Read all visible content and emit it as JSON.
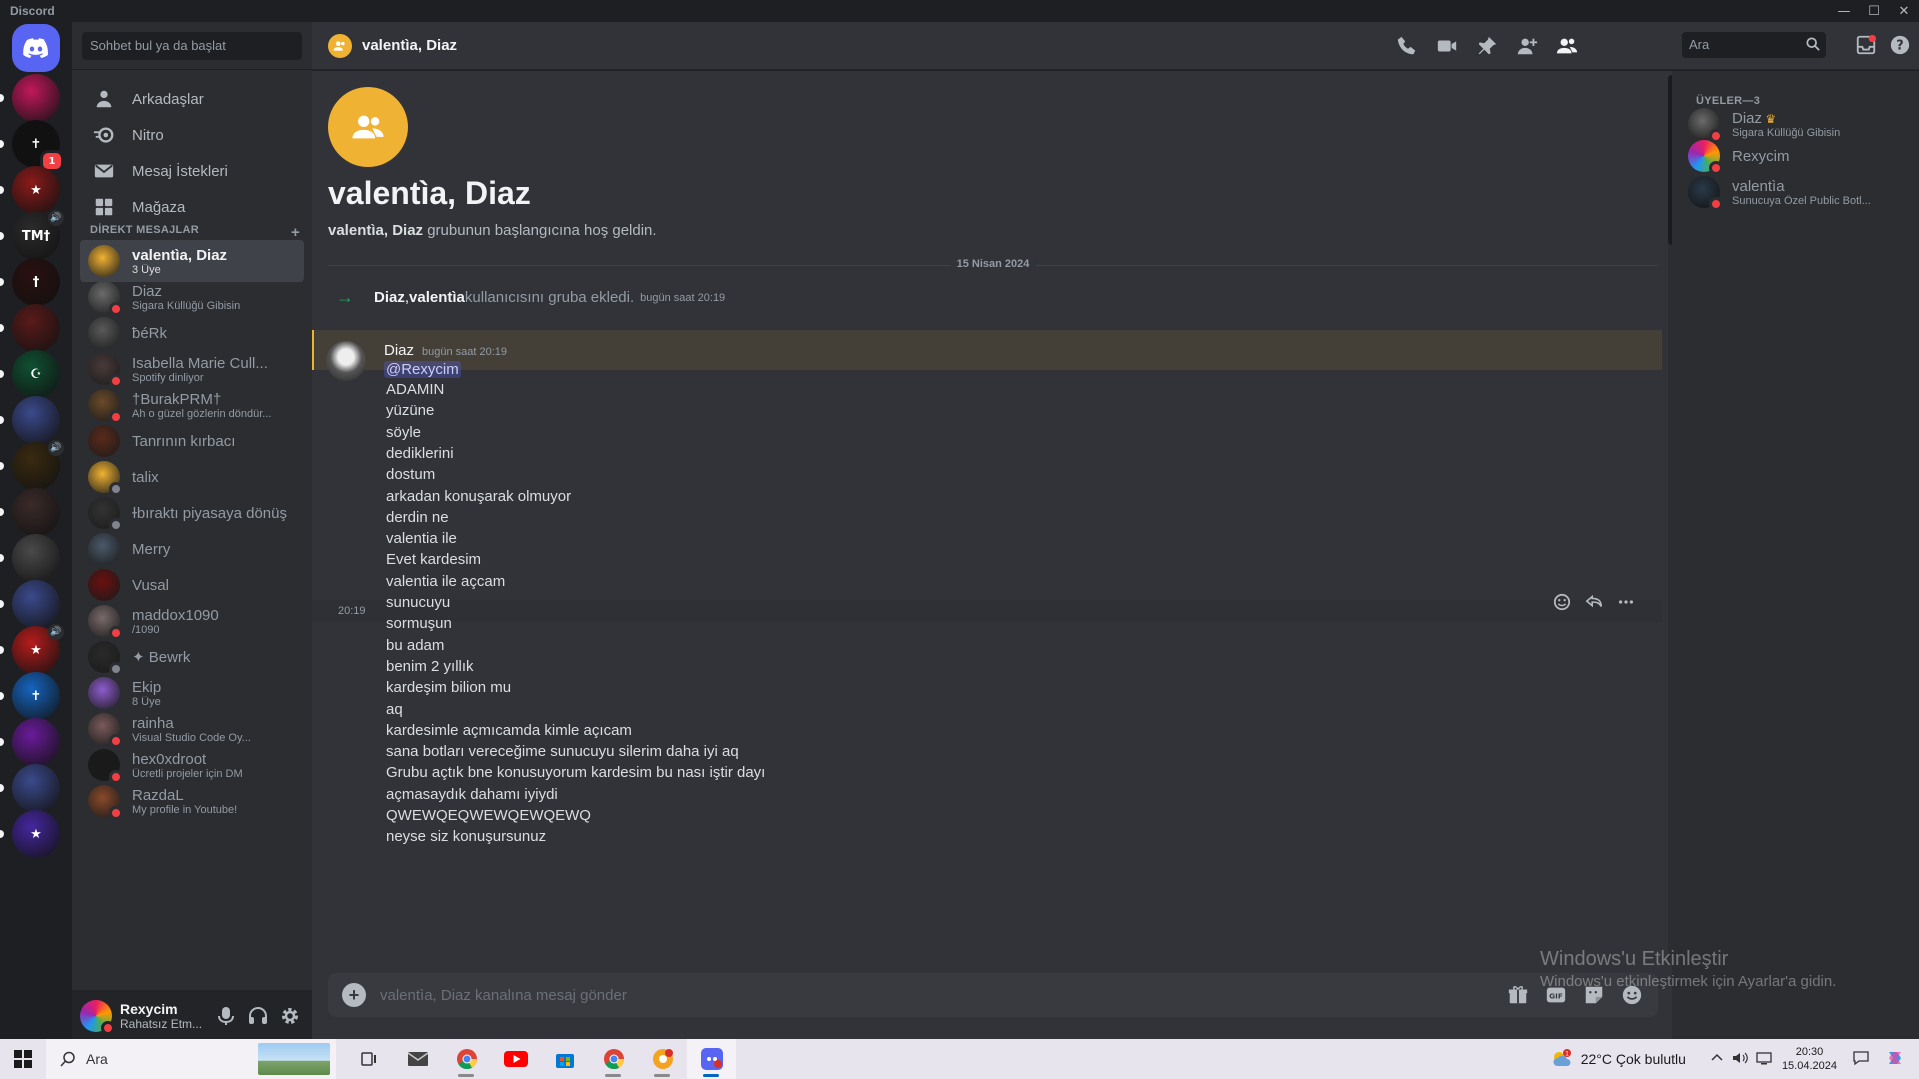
{
  "window": {
    "title": "Discord"
  },
  "rail": {
    "servers": [
      {
        "label": "",
        "color": "#c2185b"
      },
      {
        "label": "✝",
        "color": "#111111",
        "badge": "1"
      },
      {
        "label": "★",
        "color": "#8b1a1a"
      },
      {
        "label": "TM†",
        "color": "#2b2b2b"
      },
      {
        "label": "†",
        "color": "#2a1010"
      },
      {
        "label": "",
        "color": "#5a1a1a"
      },
      {
        "label": "☪",
        "color": "#0f5132"
      },
      {
        "label": "",
        "color": "#3b4a8c"
      },
      {
        "label": "",
        "color": "#3a2a10"
      },
      {
        "label": "",
        "color": "#3b2a2a"
      },
      {
        "label": "",
        "color": "#4a4a4a"
      },
      {
        "label": "",
        "color": "#3b4a8c"
      },
      {
        "label": "★",
        "color": "#b71c1c"
      },
      {
        "label": "✝",
        "color": "#1565c0"
      },
      {
        "label": "",
        "color": "#6a1b9a"
      },
      {
        "label": "",
        "color": "#3b4a8c"
      },
      {
        "label": "★",
        "color": "#4527a0"
      }
    ]
  },
  "sidebar": {
    "search_placeholder": "Sohbet bul ya da başlat",
    "nav": [
      {
        "label": "Arkadaşlar"
      },
      {
        "label": "Nitro"
      },
      {
        "label": "Mesaj İstekleri"
      },
      {
        "label": "Mağaza"
      }
    ],
    "dm_header": "DİREKT MESAJLAR",
    "dms": [
      {
        "name": "valentìa, Diaz",
        "sub": "3 Üye",
        "color": "#f0b232",
        "status": "none",
        "active": true
      },
      {
        "name": "Diaz",
        "sub": "Sigara Küllüğü Gibisin",
        "color": "#6b6b6b",
        "status": "dnd"
      },
      {
        "name": "ƀéRk",
        "sub": "",
        "color": "#5a5a5a",
        "status": "none"
      },
      {
        "name": "Isabella Marie Cull...",
        "sub": "Spotify dinliyor",
        "color": "#4a3a3a",
        "status": "dnd"
      },
      {
        "name": "†BurakPRM†",
        "sub": "Ah o güzel gözlerin döndür...",
        "color": "#6b4a2a",
        "status": "dnd"
      },
      {
        "name": "Tanrının kırbacı",
        "sub": "",
        "color": "#5a2a1a",
        "status": "none"
      },
      {
        "name": "talix",
        "sub": "",
        "color": "#f0b232",
        "status": "offline"
      },
      {
        "name": "ɫbıraktı piyasaya dönüş",
        "sub": "",
        "color": "#333333",
        "status": "offline"
      },
      {
        "name": "Merry",
        "sub": "",
        "color": "#4a5a6a",
        "status": "none"
      },
      {
        "name": "Vusal",
        "sub": "",
        "color": "#6a1010",
        "status": "none"
      },
      {
        "name": "maddox1090",
        "sub": "/1090",
        "color": "#7a6a6a",
        "status": "dnd"
      },
      {
        "name": "✦ Bewrk",
        "sub": "",
        "color": "#2a2a2a",
        "status": "offline"
      },
      {
        "name": "Ekip",
        "sub": "8 Üye",
        "color": "#8e5ccf",
        "status": "none"
      },
      {
        "name": "rainha",
        "sub": "Visual Studio Code Oy...",
        "color": "#7a5a5a",
        "status": "dnd"
      },
      {
        "name": "hex0xdroot",
        "sub": "Ücretli projeler için DM",
        "color": "#1a1a1a",
        "status": "dnd"
      },
      {
        "name": "RazdaL",
        "sub": "My profile in Youtube!",
        "color": "#8a4a2a",
        "status": "dnd"
      }
    ]
  },
  "user": {
    "name": "Rexycim",
    "status": "Rahatsız Etm..."
  },
  "header": {
    "title": "valentìa, Diaz",
    "search_placeholder": "Ara"
  },
  "chat": {
    "welcome_title": "valentìa, Diaz",
    "welcome_bold": "valentìa, Diaz",
    "welcome_rest": " grubunun başlangıcına hoş geldin.",
    "date_divider": "15 Nisan 2024",
    "system": {
      "actor": "Diaz",
      "sep": ", ",
      "target": "valentìa",
      "text": " kullanıcısını gruba ekledi.",
      "time": "bugün saat 20:19"
    },
    "author": "Diaz",
    "author_time": "bugün saat 20:19",
    "mention": "@Rexycim",
    "lines": [
      "ADAMIN",
      "yüzüne",
      "söyle",
      "dediklerini",
      "dostum",
      "arkadan konuşarak olmuyor",
      "derdin ne",
      "valentia ile",
      "Evet kardesim",
      "valentia ile açcam",
      "sunucuyu",
      "sormuşun",
      "bu adam",
      "benim 2 yıllık",
      "kardeşim bilion mu",
      "aq",
      "kardesimle açmıcamda kimle açıcam",
      "sana botları vereceğime sunucuyu silerim daha iyi aq",
      "Grubu açtık bne konusuyorum kardesim bu nası iştir dayı",
      "açmasaydık dahamı iyiydi",
      "QWEWQEQWEWQEWQEWQ",
      "neyse siz konuşursunuz"
    ],
    "hover_time": "20:19",
    "composer_placeholder": "valentìa, Diaz kanalına mesaj gönder"
  },
  "members": {
    "header": "ÜYELER—3",
    "list": [
      {
        "name": "Diaz",
        "sub": "Sigara Küllüğü Gibisin",
        "color": "#6b6b6b",
        "crown": true
      },
      {
        "name": "Rexycim",
        "sub": "",
        "color": "#e91e63"
      },
      {
        "name": "valentìa",
        "sub": "Sunucuya Özel Public Botl...",
        "color": "#2a3a4a"
      }
    ]
  },
  "watermark": {
    "title": "Windows'u Etkinleştir",
    "sub": "Windows'u etkinleştirmek için Ayarlar'a gidin."
  },
  "taskbar": {
    "search": "Ara",
    "weather": "22°C  Çok bulutlu",
    "weather_badge": "1",
    "time": "20:30",
    "date": "15.04.2024"
  }
}
